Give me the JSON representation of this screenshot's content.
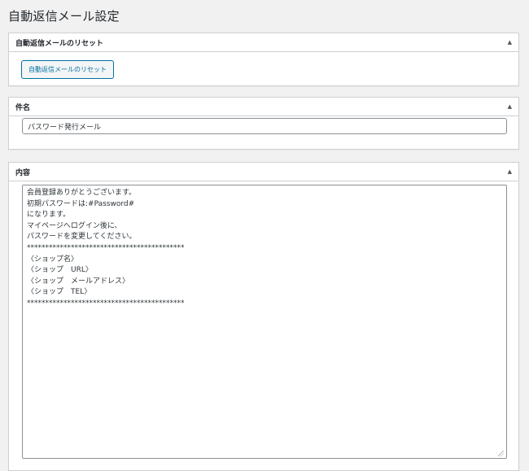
{
  "page": {
    "title": "自動返信メール設定"
  },
  "reset_box": {
    "title": "自動返信メールのリセット",
    "button_label": "自動返信メールのリセット",
    "toggle": "▲"
  },
  "subject_box": {
    "title": "件名",
    "value": "パスワード発行メール",
    "toggle": "▲"
  },
  "body_box": {
    "title": "内容",
    "value": "会員登録ありがとうございます。\n初期パスワードは:#Password#\nになります。\nマイページへログイン後に、\nパスワードを変更してください。\n*******************************************\n〈ショップ名〉\n〈ショップ　URL〉\n〈ショップ　メールアドレス〉\n〈ショップ　TEL〉\n*******************************************",
    "toggle": "▲"
  },
  "colors": {
    "page_bg": "#f1f1f1",
    "box_border": "#ccd0d4",
    "button_accent": "#0071a1"
  }
}
